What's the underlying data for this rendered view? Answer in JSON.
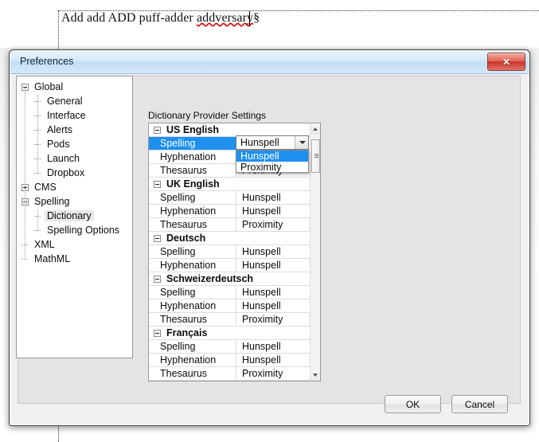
{
  "document": {
    "text_before": "Add add ADD puff-adder ",
    "misspelled_word": "addversary",
    "pilcrow": "§"
  },
  "dialog": {
    "title": "Preferences",
    "close_glyph": "✕",
    "buttons": {
      "ok": "OK",
      "cancel": "Cancel"
    }
  },
  "tree": {
    "items": [
      {
        "label": "Global",
        "indent": 0,
        "toggle": "minus",
        "selected": false
      },
      {
        "label": "General",
        "indent": 1,
        "toggle": "none",
        "selected": false
      },
      {
        "label": "Interface",
        "indent": 1,
        "toggle": "none",
        "selected": false
      },
      {
        "label": "Alerts",
        "indent": 1,
        "toggle": "none",
        "selected": false
      },
      {
        "label": "Pods",
        "indent": 1,
        "toggle": "none",
        "selected": false
      },
      {
        "label": "Launch",
        "indent": 1,
        "toggle": "none",
        "selected": false
      },
      {
        "label": "Dropbox",
        "indent": 1,
        "toggle": "none",
        "selected": false
      },
      {
        "label": "CMS",
        "indent": 0,
        "toggle": "plus",
        "selected": false
      },
      {
        "label": "Spelling",
        "indent": 0,
        "toggle": "minus",
        "selected": false
      },
      {
        "label": "Dictionary",
        "indent": 1,
        "toggle": "none",
        "selected": true
      },
      {
        "label": "Spelling Options",
        "indent": 1,
        "toggle": "none",
        "selected": false
      },
      {
        "label": "XML",
        "indent": 0,
        "toggle": "none",
        "selected": false
      },
      {
        "label": "MathML",
        "indent": 0,
        "toggle": "none",
        "selected": false
      }
    ]
  },
  "pane": {
    "title": "Dictionary Provider Settings",
    "groups": [
      {
        "name": "US English",
        "rows": [
          {
            "name": "Spelling",
            "value": "Hunspell",
            "selected": true
          },
          {
            "name": "Hyphenation",
            "value": "Hunspell",
            "selected": false
          },
          {
            "name": "Thesaurus",
            "value": "Proximity",
            "selected": false
          }
        ]
      },
      {
        "name": "UK English",
        "rows": [
          {
            "name": "Spelling",
            "value": "Hunspell",
            "selected": false
          },
          {
            "name": "Hyphenation",
            "value": "Hunspell",
            "selected": false
          },
          {
            "name": "Thesaurus",
            "value": "Proximity",
            "selected": false
          }
        ]
      },
      {
        "name": "Deutsch",
        "rows": [
          {
            "name": "Spelling",
            "value": "Hunspell",
            "selected": false
          },
          {
            "name": "Hyphenation",
            "value": "Hunspell",
            "selected": false
          }
        ]
      },
      {
        "name": "Schweizerdeutsch",
        "rows": [
          {
            "name": "Spelling",
            "value": "Hunspell",
            "selected": false
          },
          {
            "name": "Hyphenation",
            "value": "Hunspell",
            "selected": false
          },
          {
            "name": "Thesaurus",
            "value": "Proximity",
            "selected": false
          }
        ]
      },
      {
        "name": "Français",
        "rows": [
          {
            "name": "Spelling",
            "value": "Hunspell",
            "selected": false
          },
          {
            "name": "Hyphenation",
            "value": "Hunspell",
            "selected": false
          },
          {
            "name": "Thesaurus",
            "value": "Proximity",
            "selected": false
          }
        ]
      }
    ]
  },
  "combo": {
    "value": "Hunspell",
    "open": true,
    "options": [
      {
        "label": "Hunspell",
        "highlighted": true
      },
      {
        "label": "Proximity",
        "highlighted": false
      }
    ]
  },
  "colors": {
    "selection_blue": "#1e90f0",
    "close_red": "#c9342a",
    "titlebar_blue": "#c3ddf4",
    "misspell_red": "#dd0000"
  }
}
